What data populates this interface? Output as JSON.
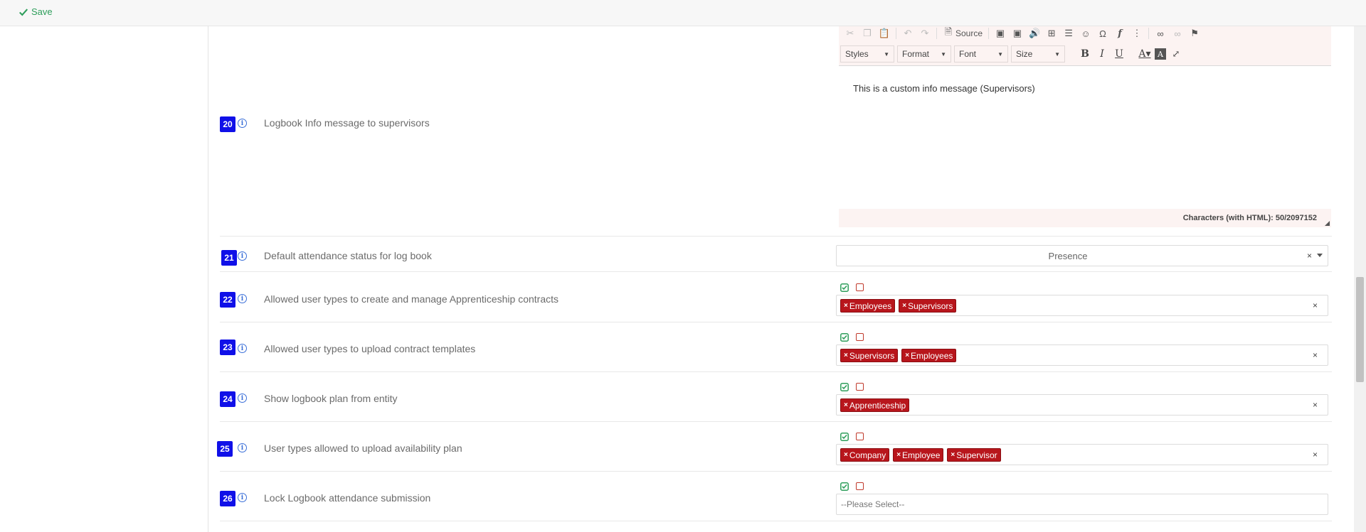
{
  "toolbar": {
    "save_label": "Save"
  },
  "editor": {
    "source_label": "Source",
    "styles_label": "Styles",
    "format_label": "Format",
    "font_label": "Font",
    "size_label": "Size",
    "content": "This is a custom info message (Supervisors)",
    "char_count": "Characters (with HTML): 50/2097152"
  },
  "rows": [
    {
      "num": "20",
      "label": "Logbook Info message to supervisors"
    },
    {
      "num": "21",
      "label": "Default attendance status for log book",
      "select_value": "Presence"
    },
    {
      "num": "22",
      "label": "Allowed user types to create and manage Apprenticeship contracts",
      "tags": [
        "Employees",
        "Supervisors"
      ]
    },
    {
      "num": "23",
      "label": "Allowed user types to upload contract templates",
      "tags": [
        "Supervisors",
        "Employees"
      ]
    },
    {
      "num": "24",
      "label": "Show logbook plan from entity",
      "tags": [
        "Apprenticeship"
      ]
    },
    {
      "num": "25",
      "label": "User types allowed to upload availability plan",
      "tags": [
        "Company",
        "Employee",
        "Supervisor"
      ]
    },
    {
      "num": "26",
      "label": "Lock Logbook attendance submission",
      "placeholder": "--Please Select--"
    }
  ],
  "colors": {
    "accent_green": "#2e9e5b",
    "badge_blue": "#1010e8",
    "tag_red": "#b8161c"
  }
}
